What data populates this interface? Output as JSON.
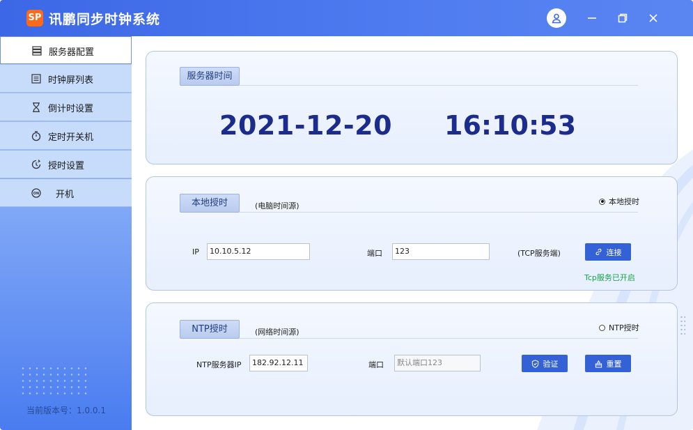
{
  "app": {
    "title": "讯鹏同步时钟系统",
    "logo_text": "SP",
    "version": "当前版本号：1.0.0.1"
  },
  "sidebar": {
    "items": [
      {
        "label": "服务器配置",
        "icon": "server-icon",
        "active": true
      },
      {
        "label": "时钟屏列表",
        "icon": "list-icon"
      },
      {
        "label": "倒计时设置",
        "icon": "hourglass-icon"
      },
      {
        "label": "定时开关机",
        "icon": "stopwatch-icon"
      },
      {
        "label": "授时设置",
        "icon": "clock-sync-icon"
      },
      {
        "label": "开机",
        "icon": "power-on-icon"
      }
    ]
  },
  "server_time": {
    "tag": "服务器时间",
    "date": "2021-12-20",
    "time": "16:10:53"
  },
  "local": {
    "tag": "本地授时",
    "source": "(电脑时间源)",
    "radio_label": "本地授时",
    "ip_label": "IP",
    "ip_value": "10.10.5.12",
    "port_label": "端口",
    "port_value": "123",
    "service_note": "(TCP服务端)",
    "connect_label": "连接",
    "status": "Tcp服务已开启"
  },
  "ntp": {
    "tag": "NTP授时",
    "source": "(网络时间源)",
    "radio_label": "NTP授时",
    "ip_label": "NTP服务器IP",
    "ip_value": "182.92.12.11",
    "port_label": "端口",
    "port_placeholder": "默认端口123",
    "verify_label": "验证",
    "reset_label": "重置"
  },
  "colors": {
    "accent": "#3461d6",
    "title_bar": "#4a74ec",
    "clock_text": "#1b2c8c",
    "status_green": "#18a34a"
  }
}
